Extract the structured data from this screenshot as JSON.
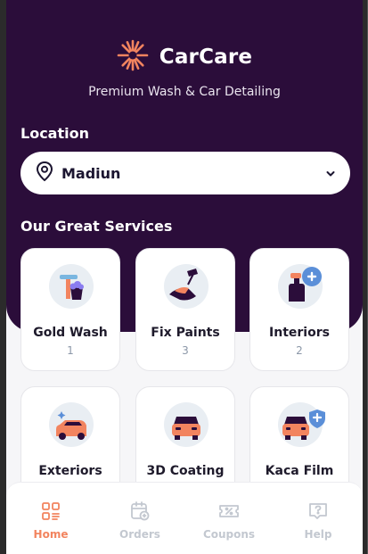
{
  "app": {
    "name": "CarCare",
    "tagline": "Premium Wash & Car Detailing",
    "brand_color": "#F2845F",
    "header_bg": "#2B0D3A"
  },
  "location": {
    "label": "Location",
    "value": "Madiun",
    "icon": "map-pin-icon",
    "dropdown_icon": "chevron-down-icon"
  },
  "services": {
    "title": "Our Great Services",
    "items": [
      {
        "name": "Gold Wash",
        "count": "1",
        "icon": "wash-bucket-icon"
      },
      {
        "name": "Fix Paints",
        "count": "3",
        "icon": "paint-roller-icon"
      },
      {
        "name": "Interiors",
        "count": "2",
        "icon": "spray-bottle-icon"
      },
      {
        "name": "Exteriors",
        "count": "",
        "icon": "sparkle-car-icon"
      },
      {
        "name": "3D Coating",
        "count": "",
        "icon": "car-front-icon"
      },
      {
        "name": "Kaca Film",
        "count": "",
        "icon": "car-shield-icon"
      }
    ]
  },
  "nav": {
    "items": [
      {
        "label": "Home",
        "icon": "home-grid-icon",
        "active": true
      },
      {
        "label": "Orders",
        "icon": "orders-calendar-icon",
        "active": false
      },
      {
        "label": "Coupons",
        "icon": "coupon-ticket-icon",
        "active": false
      },
      {
        "label": "Help",
        "icon": "help-chat-icon",
        "active": false
      }
    ]
  }
}
